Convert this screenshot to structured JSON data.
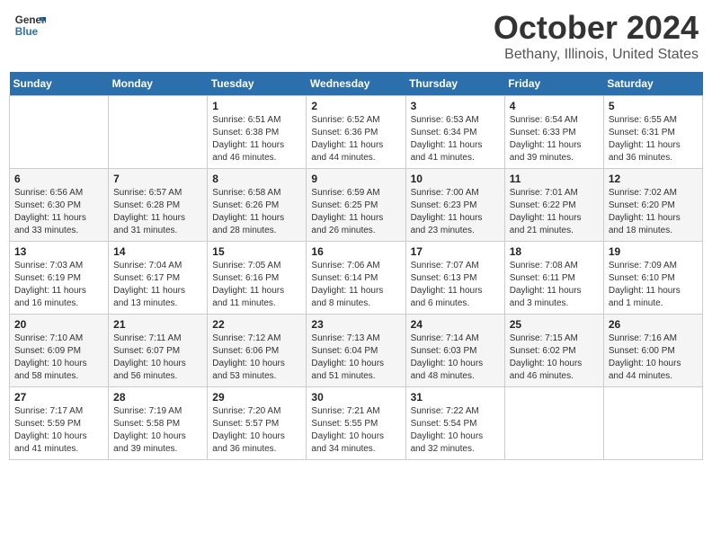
{
  "header": {
    "logo_line1": "General",
    "logo_line2": "Blue",
    "month": "October 2024",
    "location": "Bethany, Illinois, United States"
  },
  "weekdays": [
    "Sunday",
    "Monday",
    "Tuesday",
    "Wednesday",
    "Thursday",
    "Friday",
    "Saturday"
  ],
  "weeks": [
    [
      {
        "day": "",
        "info": ""
      },
      {
        "day": "",
        "info": ""
      },
      {
        "day": "1",
        "info": "Sunrise: 6:51 AM\nSunset: 6:38 PM\nDaylight: 11 hours and 46 minutes."
      },
      {
        "day": "2",
        "info": "Sunrise: 6:52 AM\nSunset: 6:36 PM\nDaylight: 11 hours and 44 minutes."
      },
      {
        "day": "3",
        "info": "Sunrise: 6:53 AM\nSunset: 6:34 PM\nDaylight: 11 hours and 41 minutes."
      },
      {
        "day": "4",
        "info": "Sunrise: 6:54 AM\nSunset: 6:33 PM\nDaylight: 11 hours and 39 minutes."
      },
      {
        "day": "5",
        "info": "Sunrise: 6:55 AM\nSunset: 6:31 PM\nDaylight: 11 hours and 36 minutes."
      }
    ],
    [
      {
        "day": "6",
        "info": "Sunrise: 6:56 AM\nSunset: 6:30 PM\nDaylight: 11 hours and 33 minutes."
      },
      {
        "day": "7",
        "info": "Sunrise: 6:57 AM\nSunset: 6:28 PM\nDaylight: 11 hours and 31 minutes."
      },
      {
        "day": "8",
        "info": "Sunrise: 6:58 AM\nSunset: 6:26 PM\nDaylight: 11 hours and 28 minutes."
      },
      {
        "day": "9",
        "info": "Sunrise: 6:59 AM\nSunset: 6:25 PM\nDaylight: 11 hours and 26 minutes."
      },
      {
        "day": "10",
        "info": "Sunrise: 7:00 AM\nSunset: 6:23 PM\nDaylight: 11 hours and 23 minutes."
      },
      {
        "day": "11",
        "info": "Sunrise: 7:01 AM\nSunset: 6:22 PM\nDaylight: 11 hours and 21 minutes."
      },
      {
        "day": "12",
        "info": "Sunrise: 7:02 AM\nSunset: 6:20 PM\nDaylight: 11 hours and 18 minutes."
      }
    ],
    [
      {
        "day": "13",
        "info": "Sunrise: 7:03 AM\nSunset: 6:19 PM\nDaylight: 11 hours and 16 minutes."
      },
      {
        "day": "14",
        "info": "Sunrise: 7:04 AM\nSunset: 6:17 PM\nDaylight: 11 hours and 13 minutes."
      },
      {
        "day": "15",
        "info": "Sunrise: 7:05 AM\nSunset: 6:16 PM\nDaylight: 11 hours and 11 minutes."
      },
      {
        "day": "16",
        "info": "Sunrise: 7:06 AM\nSunset: 6:14 PM\nDaylight: 11 hours and 8 minutes."
      },
      {
        "day": "17",
        "info": "Sunrise: 7:07 AM\nSunset: 6:13 PM\nDaylight: 11 hours and 6 minutes."
      },
      {
        "day": "18",
        "info": "Sunrise: 7:08 AM\nSunset: 6:11 PM\nDaylight: 11 hours and 3 minutes."
      },
      {
        "day": "19",
        "info": "Sunrise: 7:09 AM\nSunset: 6:10 PM\nDaylight: 11 hours and 1 minute."
      }
    ],
    [
      {
        "day": "20",
        "info": "Sunrise: 7:10 AM\nSunset: 6:09 PM\nDaylight: 10 hours and 58 minutes."
      },
      {
        "day": "21",
        "info": "Sunrise: 7:11 AM\nSunset: 6:07 PM\nDaylight: 10 hours and 56 minutes."
      },
      {
        "day": "22",
        "info": "Sunrise: 7:12 AM\nSunset: 6:06 PM\nDaylight: 10 hours and 53 minutes."
      },
      {
        "day": "23",
        "info": "Sunrise: 7:13 AM\nSunset: 6:04 PM\nDaylight: 10 hours and 51 minutes."
      },
      {
        "day": "24",
        "info": "Sunrise: 7:14 AM\nSunset: 6:03 PM\nDaylight: 10 hours and 48 minutes."
      },
      {
        "day": "25",
        "info": "Sunrise: 7:15 AM\nSunset: 6:02 PM\nDaylight: 10 hours and 46 minutes."
      },
      {
        "day": "26",
        "info": "Sunrise: 7:16 AM\nSunset: 6:00 PM\nDaylight: 10 hours and 44 minutes."
      }
    ],
    [
      {
        "day": "27",
        "info": "Sunrise: 7:17 AM\nSunset: 5:59 PM\nDaylight: 10 hours and 41 minutes."
      },
      {
        "day": "28",
        "info": "Sunrise: 7:19 AM\nSunset: 5:58 PM\nDaylight: 10 hours and 39 minutes."
      },
      {
        "day": "29",
        "info": "Sunrise: 7:20 AM\nSunset: 5:57 PM\nDaylight: 10 hours and 36 minutes."
      },
      {
        "day": "30",
        "info": "Sunrise: 7:21 AM\nSunset: 5:55 PM\nDaylight: 10 hours and 34 minutes."
      },
      {
        "day": "31",
        "info": "Sunrise: 7:22 AM\nSunset: 5:54 PM\nDaylight: 10 hours and 32 minutes."
      },
      {
        "day": "",
        "info": ""
      },
      {
        "day": "",
        "info": ""
      }
    ]
  ]
}
